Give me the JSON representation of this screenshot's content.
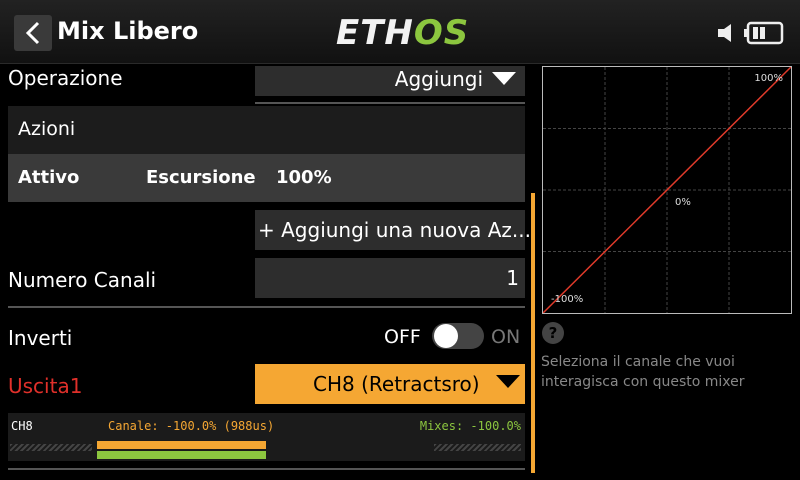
{
  "header": {
    "title": "Mix Libero",
    "logo_left": "ETH",
    "logo_right": "OS",
    "icons": [
      "back-chevron-icon",
      "speaker-icon",
      "battery-icon"
    ]
  },
  "form": {
    "operazione": {
      "label": "Operazione",
      "value": "Aggiungi"
    },
    "azioni": {
      "label": "Azioni",
      "row": {
        "attivo": "Attivo",
        "escursione_label": "Escursione",
        "escursione_value": "100%"
      }
    },
    "add_action": "+ Aggiungi una nuova Az...",
    "numero_canali": {
      "label": "Numero Canali",
      "value": "1"
    },
    "inverti": {
      "label": "Inverti",
      "off": "OFF",
      "on": "ON",
      "state": "off"
    },
    "uscita": {
      "label": "Uscita1",
      "value": "CH8 (Retractsro)"
    },
    "channel_monitor": {
      "channel": "CH8",
      "canale": "Canale: -100.0% (988us)",
      "mixes": "Mixes: -100.0%",
      "canale_value_percent": -100.0,
      "mixes_value_percent": -100.0
    }
  },
  "graph": {
    "label_max": "100%",
    "label_mid": "0%",
    "label_min": "-100%",
    "curve": {
      "x": [
        -100,
        100
      ],
      "y": [
        -100,
        100
      ]
    }
  },
  "help": {
    "icon": "question-icon",
    "text": "Seleziona il canale che vuoi interagisca con questo mixer"
  },
  "colors": {
    "accent_orange": "#f5a733",
    "accent_green": "#8cc63f",
    "label_red": "#e0302a",
    "curve_red": "#e03a2a"
  }
}
